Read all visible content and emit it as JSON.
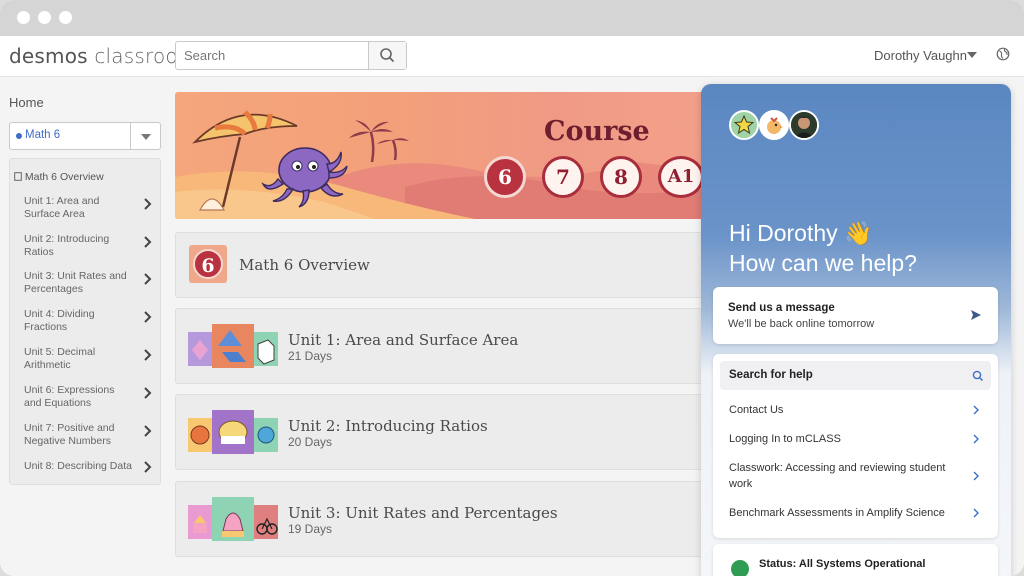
{
  "app": {
    "logo_primary": "desmos",
    "logo_secondary": "classroom",
    "search_placeholder": "Search",
    "user_name": "Dorothy Vaughn"
  },
  "sidebar": {
    "home_label": "Home",
    "course_selected": "Math 6",
    "overview_label": "Math 6 Overview",
    "units": [
      {
        "label": "Unit 1: Area and Surface Area"
      },
      {
        "label": "Unit 2: Introducing Ratios"
      },
      {
        "label": "Unit 3: Unit Rates and Percentages"
      },
      {
        "label": "Unit 4: Dividing Fractions"
      },
      {
        "label": "Unit 5: Decimal Arithmetic"
      },
      {
        "label": "Unit 6: Expressions and Equations"
      },
      {
        "label": "Unit 7: Positive and Negative Numbers"
      },
      {
        "label": "Unit 8: Describing Data"
      }
    ]
  },
  "banner": {
    "title": "Course",
    "courses": [
      "6",
      "7",
      "8",
      "A1"
    ],
    "active_course": "6"
  },
  "main": {
    "overview_badge": "6",
    "overview_title": "Math 6 Overview",
    "cards": [
      {
        "title": "Unit 1: Area and Surface Area",
        "days": "21 Days"
      },
      {
        "title": "Unit 2: Introducing Ratios",
        "days": "20 Days"
      },
      {
        "title": "Unit 3: Unit Rates and Percentages",
        "days": "19 Days"
      }
    ]
  },
  "help": {
    "greeting_line1": "Hi Dorothy 👋",
    "greeting_line2": "How can we help?",
    "message_title": "Send us a message",
    "message_sub": "We'll be back online tomorrow",
    "search_label": "Search for help",
    "links": [
      {
        "label": "Contact Us"
      },
      {
        "label": "Logging In to mCLASS"
      },
      {
        "label": "Classwork: Accessing and reviewing student work"
      },
      {
        "label": "Benchmark Assessments in Amplify Science"
      }
    ],
    "status_label": "Status: All Systems Operational"
  },
  "colors": {
    "accent": "#3d6cc7",
    "course_red": "#b8323f",
    "panel_blue": "#5b87c1"
  }
}
